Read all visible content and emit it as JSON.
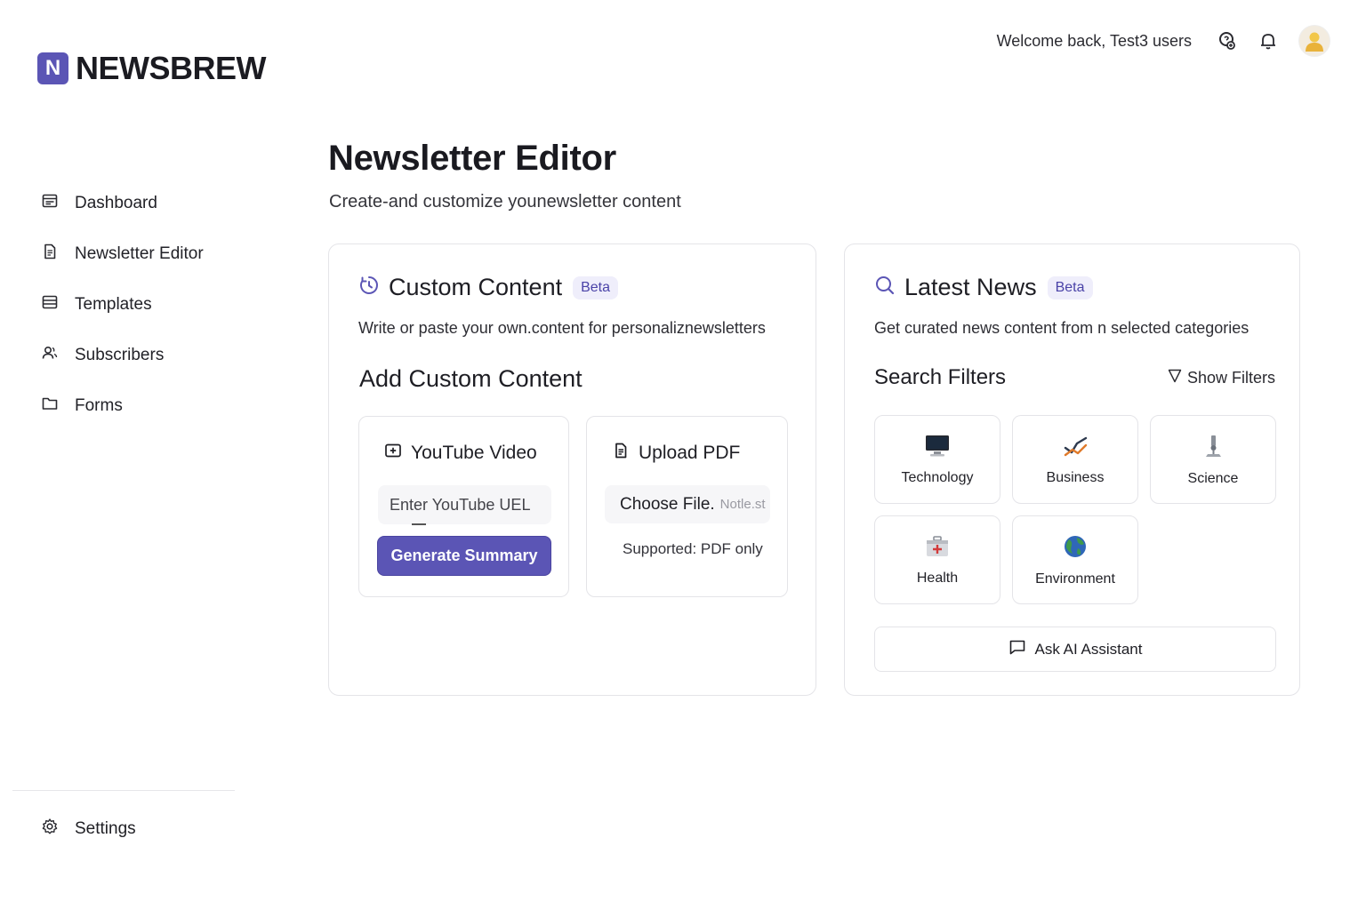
{
  "brand": {
    "logo_letter": "N",
    "name": "NEWSBREW",
    "accent": "#5b55b5"
  },
  "header": {
    "welcome": "Welcome back, Test3 users"
  },
  "sidebar": {
    "items": [
      {
        "label": "Dashboard",
        "icon": "dashboard-icon"
      },
      {
        "label": "Newsletter Editor",
        "icon": "document-icon"
      },
      {
        "label": "Templates",
        "icon": "template-icon"
      },
      {
        "label": "Subscribers",
        "icon": "users-icon"
      },
      {
        "label": "Forms",
        "icon": "folder-icon"
      }
    ],
    "settings": {
      "label": "Settings",
      "icon": "gear-icon"
    }
  },
  "page": {
    "title": "Newsletter Editor",
    "subtitle": "Create-and customize younewsletter content"
  },
  "custom_content": {
    "title": "Custom Content",
    "badge": "Beta",
    "description": "Write or paste your own.content for personaliznewsletters",
    "section_title": "Add Custom Content",
    "youtube": {
      "title": "YouTube Video",
      "placeholder": "Enter YouTube UEL",
      "button": "Generate Summary"
    },
    "pdf": {
      "title": "Upload PDF",
      "choose_label": "Choose File.",
      "no_file_label": "Notle.st",
      "note": "Supported: PDF only"
    }
  },
  "latest_news": {
    "title": "Latest News",
    "badge": "Beta",
    "description": "Get curated news content from n selected categories",
    "filters_title": "Search Filters",
    "show_filters": "Show Filters",
    "categories": [
      {
        "label": "Technology",
        "icon": "monitor-icon"
      },
      {
        "label": "Business",
        "icon": "chart-trend-icon"
      },
      {
        "label": "Science",
        "icon": "microscope-icon"
      },
      {
        "label": "Health",
        "icon": "first-aid-kit-icon"
      },
      {
        "label": "Environment",
        "icon": "globe-icon"
      }
    ],
    "ai_button": "Ask AI Assistant"
  }
}
